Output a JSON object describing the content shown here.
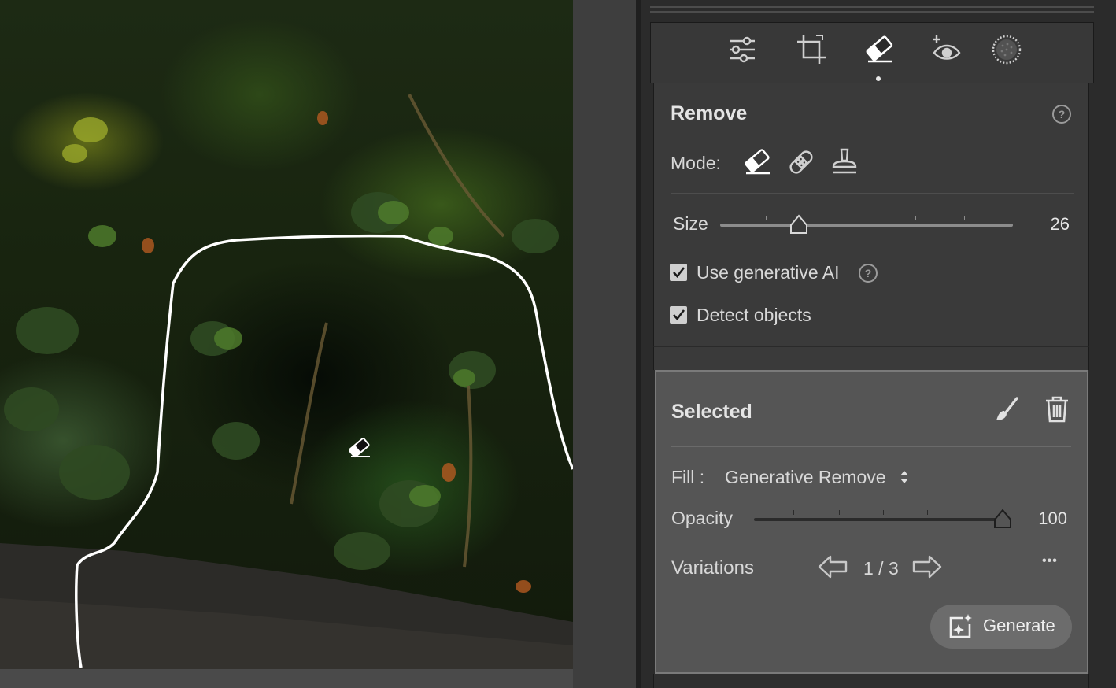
{
  "canvas": {
    "cursor_icon": "eraser-cursor-icon",
    "selection_outline": "white brush selection outline"
  },
  "toolbar": {
    "tools": [
      {
        "icon": "edit-sliders-icon"
      },
      {
        "icon": "crop-icon"
      },
      {
        "icon": "remove-eraser-icon",
        "active": true
      },
      {
        "icon": "red-eye-icon"
      },
      {
        "icon": "masking-icon"
      }
    ]
  },
  "remove": {
    "title": "Remove",
    "help": "?",
    "mode_label": "Mode:",
    "modes": [
      "remove-eraser-icon",
      "heal-bandage-icon",
      "clone-stamp-icon"
    ],
    "size_label": "Size",
    "size_value": "26",
    "size_fraction": 0.27,
    "use_ai_label": "Use generative AI",
    "use_ai_checked": true,
    "detect_label": "Detect objects",
    "detect_checked": true
  },
  "selected": {
    "title": "Selected",
    "fill_label": "Fill :",
    "fill_value": "Generative Remove",
    "opacity_label": "Opacity",
    "opacity_value": "100",
    "opacity_fraction": 1.0,
    "variations_label": "Variations",
    "variations_counter": "1 / 3",
    "more": "•••",
    "generate_label": "Generate"
  },
  "colors": {
    "panel_bg": "#2b2b2b",
    "section_bg": "#3a3a3a",
    "selected_bg": "#555555",
    "selection_stroke": "#ffffff"
  }
}
